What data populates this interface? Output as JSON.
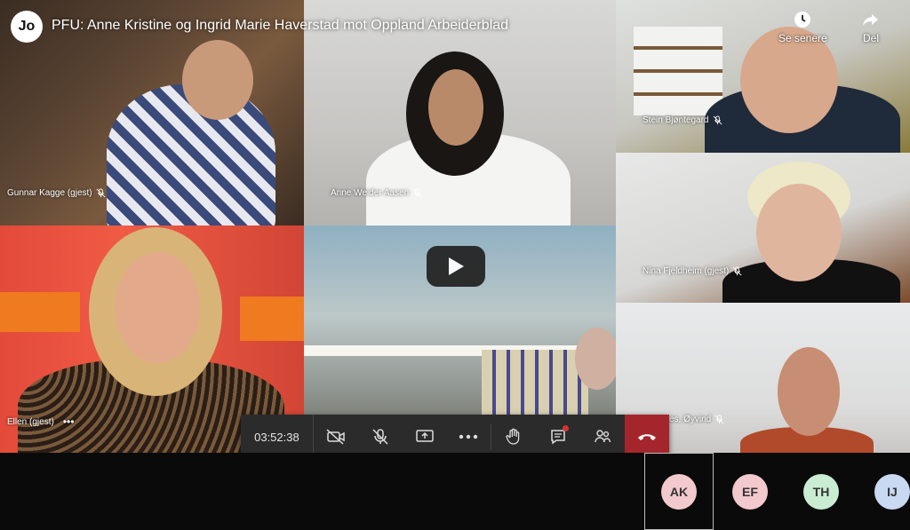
{
  "video": {
    "channel_logo": "Jo",
    "title": "PFU: Anne Kristine og Ingrid Marie Haverstad mot Oppland Arbeiderblad",
    "watch_later_label": "Se senere",
    "share_label": "Del"
  },
  "participants": {
    "gunnar": "Gunnar Kagge (gjest)",
    "anne": "Anne Weider Aasen",
    "stein": "Stein Bjøntegard",
    "nina": "Nina Fjeldheim (gjest)",
    "ellen": "Ellen (gjest)",
    "oyvind": "es, Øyvind"
  },
  "tile_icons": {
    "more": "more-horizontal-icon",
    "mic": "mic-off-icon"
  },
  "controls": {
    "timer": "03:52:38",
    "icons": [
      "camera-off-icon",
      "mic-off-icon",
      "share-screen-icon",
      "more-icon",
      "raise-hand-icon",
      "chat-icon",
      "participants-icon",
      "hang-up-icon"
    ],
    "hangup_color": "#a4262c"
  },
  "roster": [
    {
      "initials": "AK",
      "color": "#f2c9cc"
    },
    {
      "initials": "EF",
      "color": "#f2c9cc"
    },
    {
      "initials": "TH",
      "color": "#c9ecd2"
    },
    {
      "initials": "IJ",
      "color": "#c9d9f2"
    }
  ]
}
